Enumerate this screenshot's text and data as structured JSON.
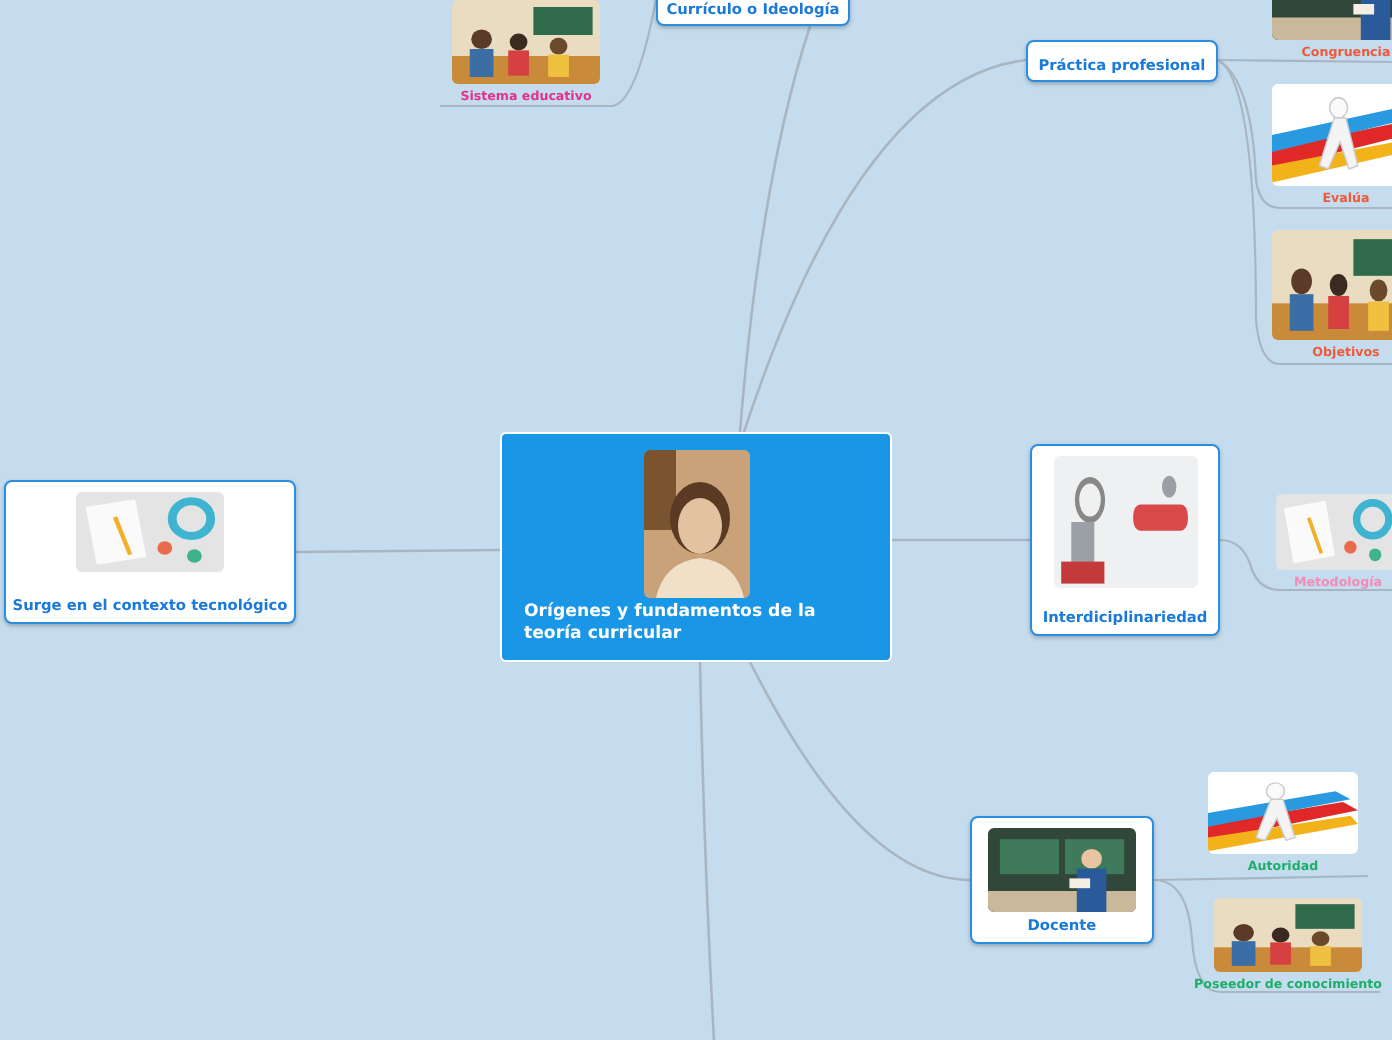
{
  "central": {
    "title": "Orígenes y fundamentos de la teoría curricular",
    "picture": true
  },
  "topics": [
    {
      "title": "Currículo o Ideología",
      "picture": false,
      "children": [
        {
          "title": "Sistema educativo",
          "color": "#e0338a"
        }
      ]
    },
    {
      "title": "Práctica profesional",
      "picture": false,
      "children": [
        {
          "title": "Congruencia",
          "color": "#ef5a3a"
        },
        {
          "title": "Evalúa",
          "color": "#ef5a3a"
        },
        {
          "title": "Objetivos",
          "color": "#ef5a3a"
        }
      ]
    },
    {
      "title": "Interdiciplinariedad",
      "picture": true,
      "children": [
        {
          "title": "Metodología",
          "color": "#f28bb8"
        }
      ]
    },
    {
      "title": "Docente",
      "picture": true,
      "children": [
        {
          "title": "Autoridad",
          "color": "#1fae6a"
        },
        {
          "title": "Poseedor de conocimiento",
          "color": "#1fae6a"
        }
      ]
    },
    {
      "title": "Surge en el contexto tecnológico",
      "picture": true
    }
  ]
}
